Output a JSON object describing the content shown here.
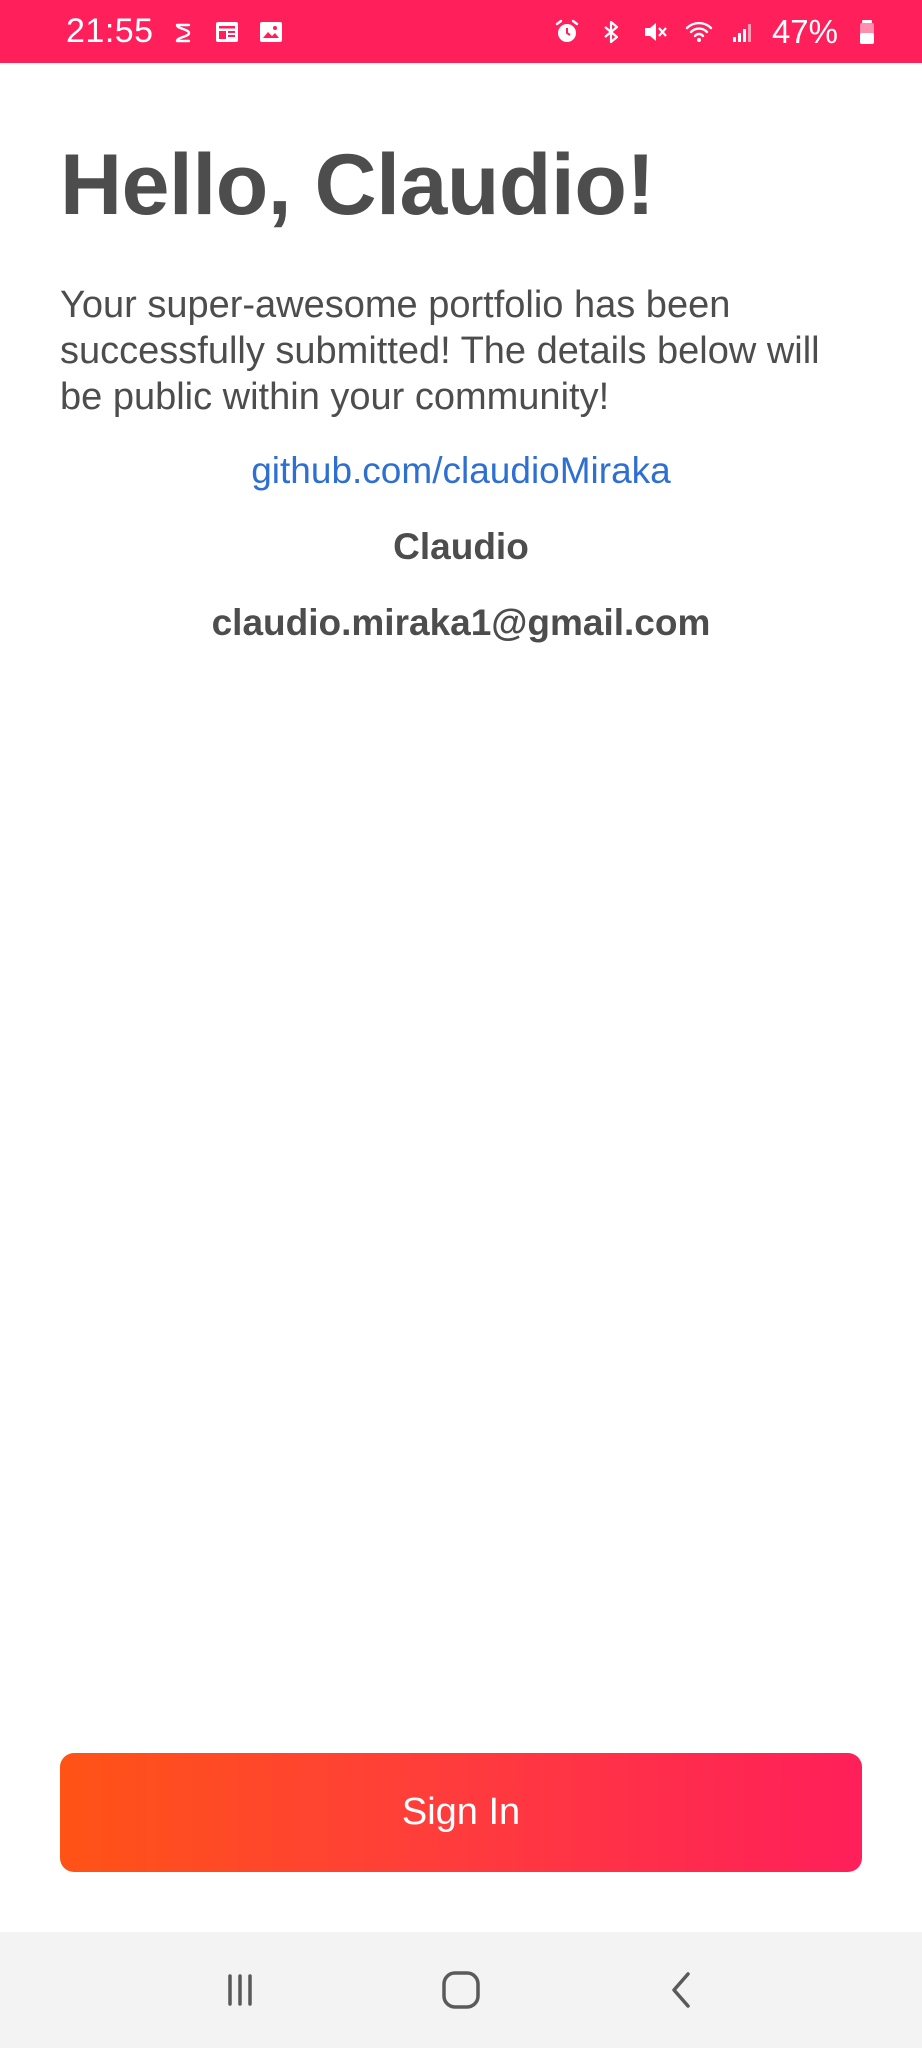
{
  "status_bar": {
    "time": "21:55",
    "battery": "47%",
    "left_icons": [
      "sync-icon",
      "news-icon",
      "gallery-icon"
    ],
    "right_icons": [
      "alarm-icon",
      "bluetooth-icon",
      "mute-icon",
      "wifi-icon",
      "signal-icon",
      "battery-icon"
    ],
    "color": "#ff1f5a"
  },
  "main": {
    "greeting": "Hello, Claudio!",
    "message": "Your super-awesome portfolio has been successfully submitted! The details below will be public within your community!",
    "github_link": "github.com/claudioMiraka",
    "name": "Claudio",
    "email": "claudio.miraka1@gmail.com"
  },
  "actions": {
    "sign_in_label": "Sign In",
    "gradient_start": "#ff5316",
    "gradient_end": "#ff1f5a"
  },
  "nav_bar": {
    "buttons": [
      "recent-apps-icon",
      "home-icon",
      "back-icon"
    ]
  },
  "colors": {
    "text": "#4d4d4d",
    "link": "#2e6fd1"
  }
}
